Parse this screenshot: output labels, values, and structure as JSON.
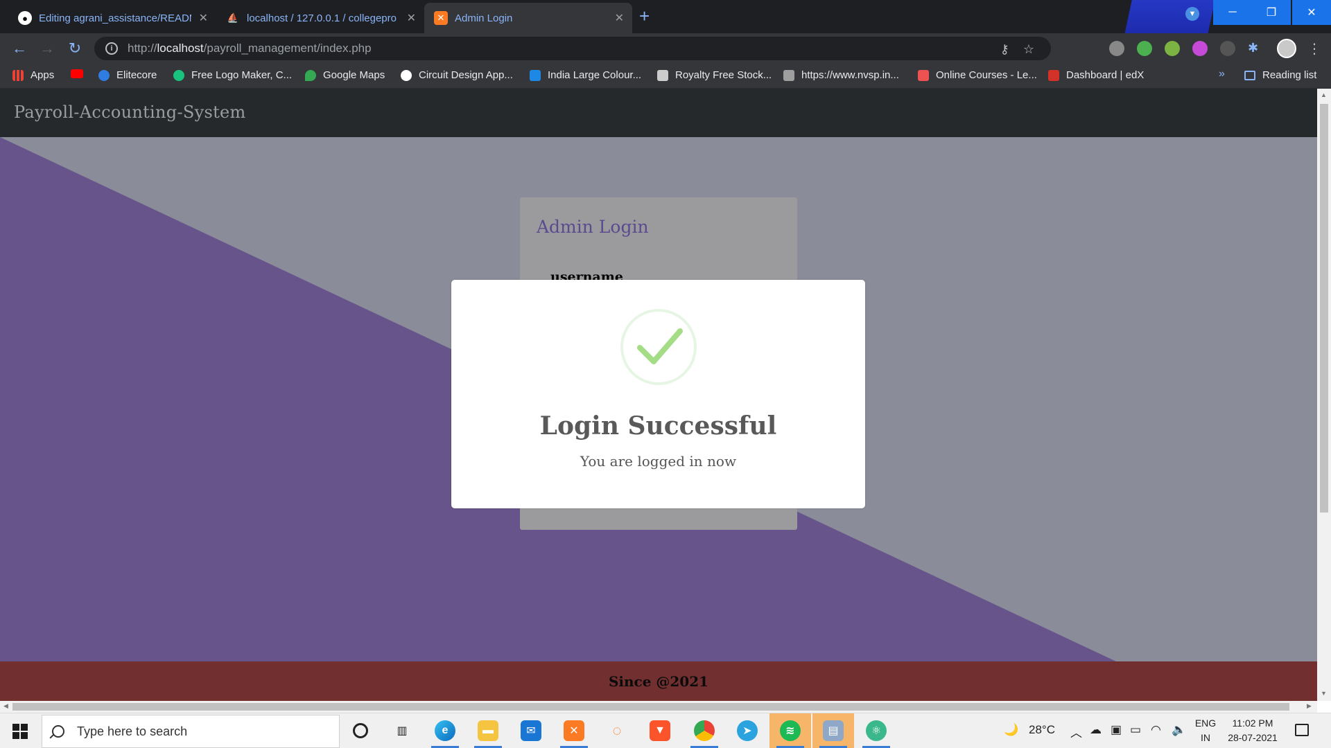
{
  "browser": {
    "tabs": [
      {
        "title": "Editing agrani_assistance/READM",
        "icon": "github-icon",
        "active": false
      },
      {
        "title": "localhost / 127.0.0.1 / collegepro",
        "icon": "phpmyadmin-icon",
        "active": false
      },
      {
        "title": "Admin Login",
        "icon": "xampp-icon",
        "active": true
      }
    ],
    "new_tab": "+",
    "address": {
      "protocol": "http://",
      "host": "localhost",
      "path": "/payroll_management/index.php"
    },
    "bookmarks": [
      {
        "label": "Apps",
        "color": "#ea4335"
      },
      {
        "label": "",
        "color": "#ff0000"
      },
      {
        "label": "Elitecore",
        "color": "#2f7de1"
      },
      {
        "label": "Free Logo Maker, C...",
        "color": "#19c37d"
      },
      {
        "label": "Google Maps",
        "color": "#34a853"
      },
      {
        "label": "Circuit Design App...",
        "color": "#ffffff"
      },
      {
        "label": "India Large Colour...",
        "color": "#1e88e5"
      },
      {
        "label": "Royalty Free Stock...",
        "color": "#cccccc"
      },
      {
        "label": "https://www.nvsp.in...",
        "color": "#9e9e9e"
      },
      {
        "label": "Online Courses - Le...",
        "color": "#ec5252"
      },
      {
        "label": "Dashboard | edX",
        "color": "#d23228"
      }
    ],
    "reading_list": "Reading list",
    "more_bookmarks": "»"
  },
  "page": {
    "brand": "Payroll-Accounting-System",
    "login_card": {
      "title": "Admin Login",
      "label": "username"
    },
    "footer": "Since @2021",
    "colors": {
      "purple": "#66548a",
      "grey": "#8a8c9a",
      "navbar": "#26292c",
      "footer": "#722f30"
    }
  },
  "modal": {
    "title": "Login Successful",
    "text": "You are logged in now",
    "icon": "success-check-icon"
  },
  "taskbar": {
    "search_placeholder": "Type here to search",
    "weather": "28°C",
    "lang_top": "ENG",
    "lang_bottom": "IN",
    "time": "11:02 PM",
    "date": "28-07-2021"
  }
}
